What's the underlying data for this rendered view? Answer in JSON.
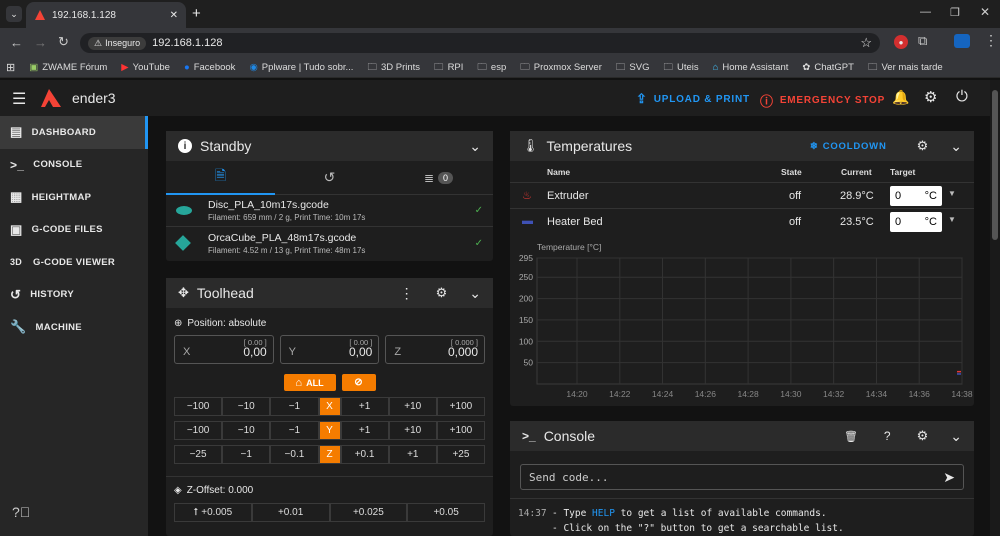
{
  "browser": {
    "tab_title": "192.168.1.128",
    "security_label": "Inseguro",
    "url": "192.168.1.128",
    "bookmarks": [
      "ZWAME Fórum",
      "YouTube",
      "Facebook",
      "Pplware | Tudo sobr...",
      "3D Prints",
      "RPI",
      "esp",
      "Proxmox Server",
      "SVG",
      "Uteis",
      "Home Assistant",
      "ChatGPT",
      "Ver mais tarde"
    ]
  },
  "app": {
    "printer_name": "ender3",
    "upload_label": "UPLOAD & PRINT",
    "estop_label": "EMERGENCY STOP",
    "brand_color": "#f44336",
    "accent": "#2196f3"
  },
  "nav": [
    "DASHBOARD",
    "CONSOLE",
    "HEIGHTMAP",
    "G-CODE FILES",
    "G-CODE VIEWER",
    "HISTORY",
    "MACHINE"
  ],
  "nav_icon_3d": "3D",
  "standby": {
    "title": "Standby",
    "queue_count": "0",
    "files": [
      {
        "name": "Disc_PLA_10m17s.gcode",
        "info": "Filament: 659 mm / 2 g, Print Time: 10m 17s"
      },
      {
        "name": "OrcaCube_PLA_48m17s.gcode",
        "info": "Filament: 4.52 m / 13 g, Print Time: 48m 17s"
      }
    ]
  },
  "toolhead": {
    "title": "Toolhead",
    "position_label": "Position: absolute",
    "axes": [
      {
        "label": "X",
        "value": "0,00",
        "range": "[ 0.00 ]"
      },
      {
        "label": "Y",
        "value": "0,00",
        "range": "[ 0.00 ]"
      },
      {
        "label": "Z",
        "value": "0,000",
        "range": "[ 0.000 ]"
      }
    ],
    "home_all": "ALL",
    "jog_x": [
      "−100",
      "−10",
      "−1",
      "X",
      "+1",
      "+10",
      "+100"
    ],
    "jog_y": [
      "−100",
      "−10",
      "−1",
      "Y",
      "+1",
      "+10",
      "+100"
    ],
    "jog_z": [
      "−25",
      "−1",
      "−0.1",
      "Z",
      "+0.1",
      "+1",
      "+25"
    ],
    "zoffset_label": "Z-Offset: 0.000",
    "zoffset_steps": [
      "+0.005",
      "+0.01",
      "+0.025",
      "+0.05"
    ]
  },
  "temps": {
    "title": "Temperatures",
    "cooldown": "COOLDOWN",
    "headers": [
      "Name",
      "State",
      "Current",
      "Target"
    ],
    "rows": [
      {
        "name": "Extruder",
        "state": "off",
        "current": "28.9°C",
        "target": "0",
        "unit": "°C"
      },
      {
        "name": "Heater Bed",
        "state": "off",
        "current": "23.5°C",
        "target": "0",
        "unit": "°C"
      }
    ]
  },
  "chart_data": {
    "type": "line",
    "ylabel": "Temperature [°C]",
    "ylim": [
      0,
      295
    ],
    "yticks": [
      "295",
      "250",
      "200",
      "150",
      "100",
      "50"
    ],
    "xticks": [
      "14:20",
      "14:22",
      "14:24",
      "14:26",
      "14:28",
      "14:30",
      "14:32",
      "14:34",
      "14:36",
      "14:38"
    ],
    "series": [
      {
        "name": "Extruder",
        "color": "#e53935",
        "values": [
          28.9
        ]
      },
      {
        "name": "Heater Bed",
        "color": "#3f51b5",
        "values": [
          23.5
        ]
      }
    ]
  },
  "console": {
    "title": "Console",
    "input_placeholder": "Send code...",
    "log_time": "14:37",
    "log_pre": "- Type ",
    "log_help": "HELP",
    "log_post": " to get a list of available commands.",
    "log_line2": "- Click on the \"?\" button to get a searchable list."
  }
}
